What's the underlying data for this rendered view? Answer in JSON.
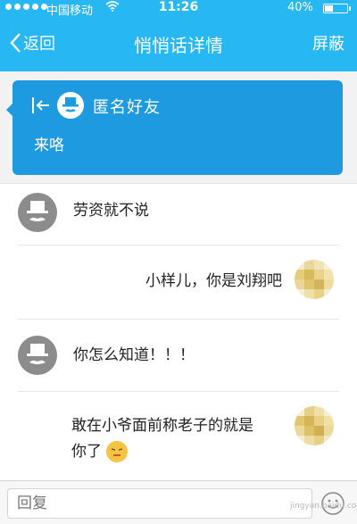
{
  "status": {
    "carrier": "中国移动",
    "time": "11:26",
    "battery": "40%",
    "battery_level": 0.4
  },
  "nav": {
    "back_label": "返回",
    "title": "悄悄话详情",
    "block_label": "屏蔽"
  },
  "card": {
    "name": "匿名好友",
    "message": "来咯"
  },
  "messages": [
    {
      "side": "left",
      "text": "劳资就不说"
    },
    {
      "side": "right",
      "text": "小样儿，你是刘翔吧"
    },
    {
      "side": "left",
      "text": "你怎么知道！！！"
    },
    {
      "side": "right",
      "line1": "敢在小爷面前称老子的就是",
      "line2": "你了"
    }
  ],
  "input": {
    "placeholder": "回复"
  },
  "watermark": "jingyan.baidu.com"
}
